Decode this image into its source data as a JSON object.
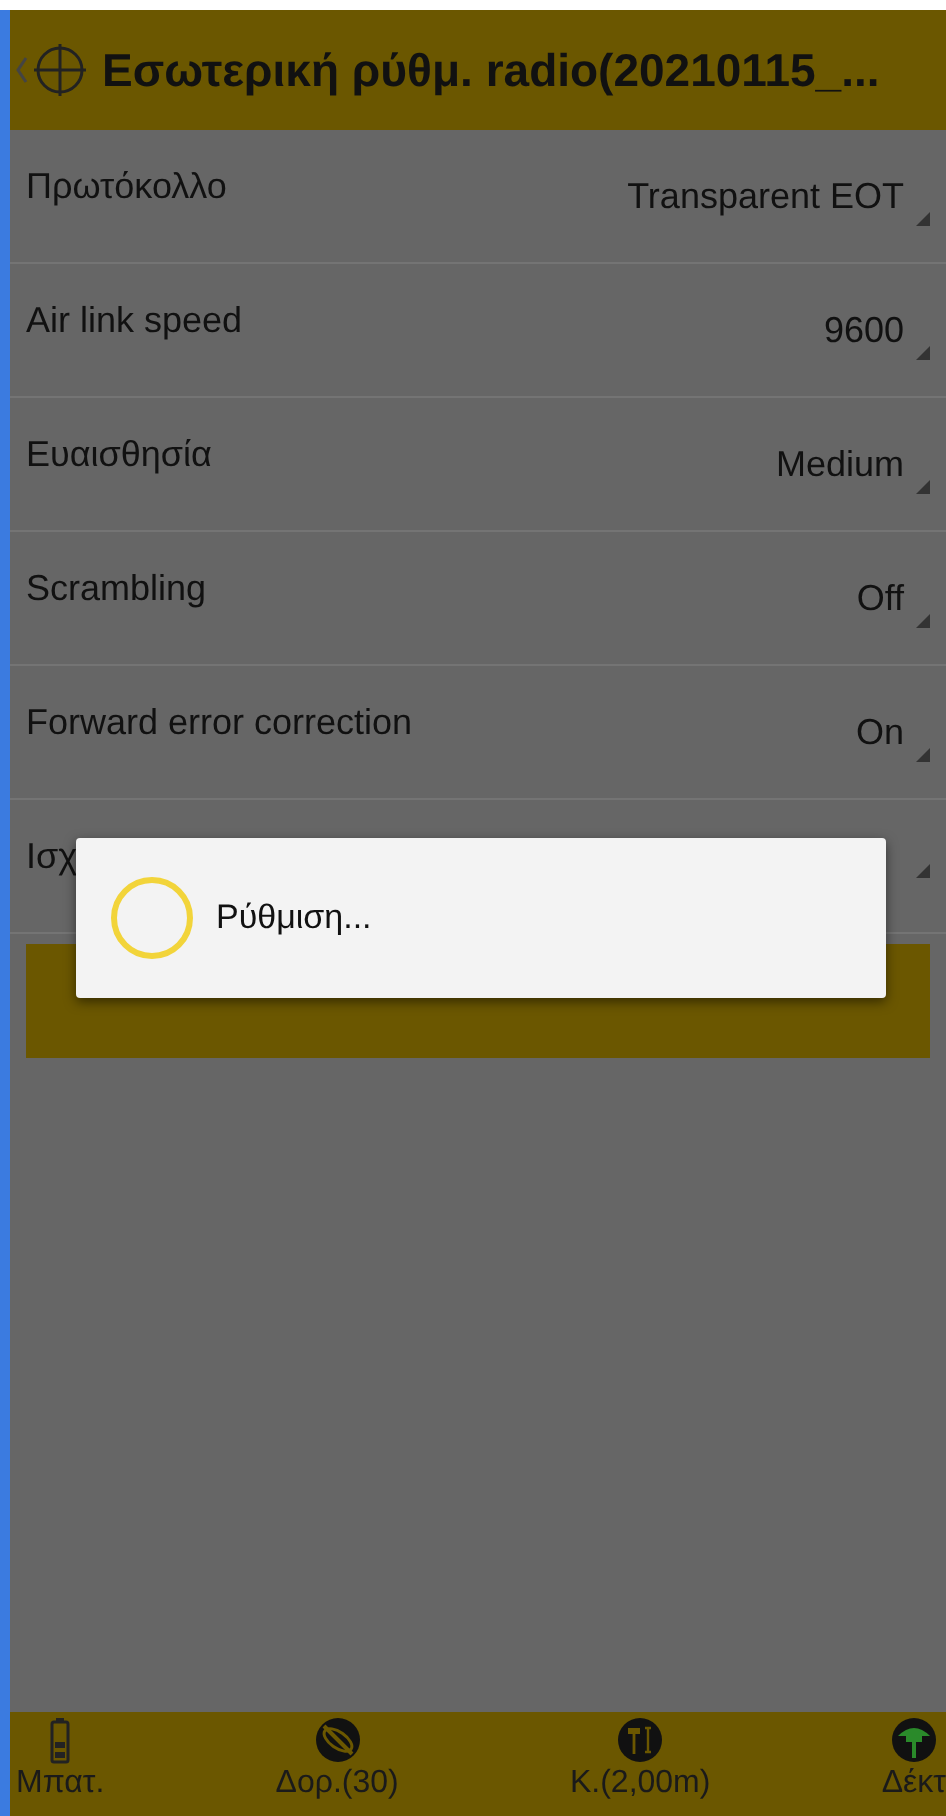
{
  "header": {
    "title": "Εσωτερική ρύθμ. radio(20210115_..."
  },
  "settings": [
    {
      "label": "Πρωτόκολλο",
      "value": "Transparent EOT"
    },
    {
      "label": "Air link speed",
      "value": "9600"
    },
    {
      "label": "Ευαισθησία",
      "value": "Medium"
    },
    {
      "label": "Scrambling",
      "value": "Off"
    },
    {
      "label": "Forward error correction",
      "value": "On"
    },
    {
      "label": "Ισχ"
    }
  ],
  "ok_button": {
    "kind": "button"
  },
  "dialog": {
    "message": "Ρύθμιση..."
  },
  "bottom_bar": [
    {
      "kind": "battery",
      "label": "Μπατ."
    },
    {
      "kind": "satellite",
      "label": "Δορ.(30)"
    },
    {
      "kind": "pole",
      "label": "Κ.(2,00m)"
    },
    {
      "kind": "receiver",
      "label": "Δέκτ"
    }
  ]
}
